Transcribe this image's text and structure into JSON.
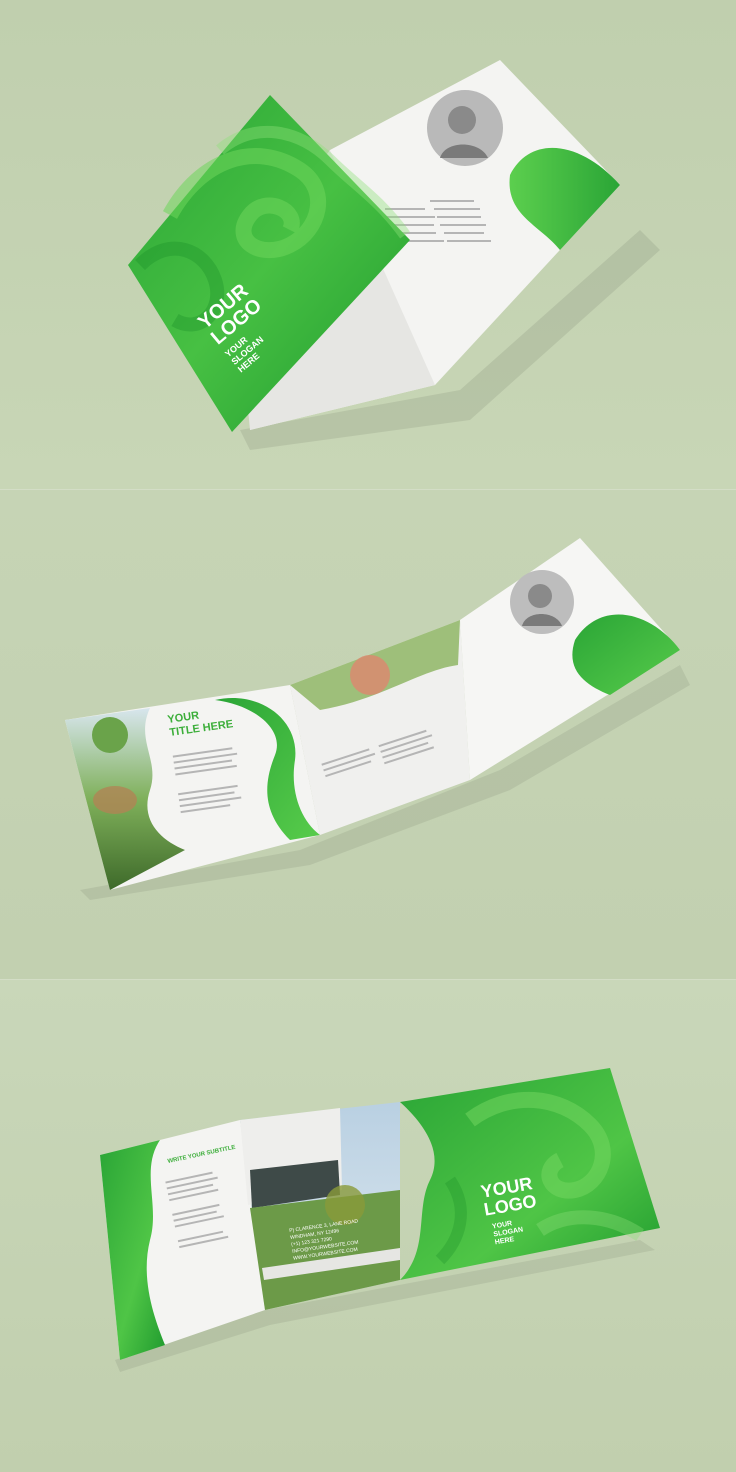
{
  "cover": {
    "logo_line1": "YOUR",
    "logo_line2": "LOGO",
    "slogan_line1": "YOUR",
    "slogan_line2": "SLOGAN",
    "slogan_line3": "HERE"
  },
  "inside": {
    "title_line1": "YOUR",
    "title_line2": "TITLE HERE"
  },
  "back": {
    "subtitle": "WRITE YOUR SUBTITLE",
    "address_line1": "P) CLARENCE 3, LANE ROAD",
    "address_line2": "WINDHAM, NY 12496",
    "address_line3": "(+1) 123 321 7290",
    "address_line4": "INFO@YOURWEBSITE.COM",
    "address_line5": "WWW.YOURWEBSITE.COM"
  },
  "colors": {
    "brand_green": "#3cae3a",
    "dark_green": "#1f9a2e",
    "light_green": "#6fd25a",
    "background": "#c4d2b2"
  }
}
